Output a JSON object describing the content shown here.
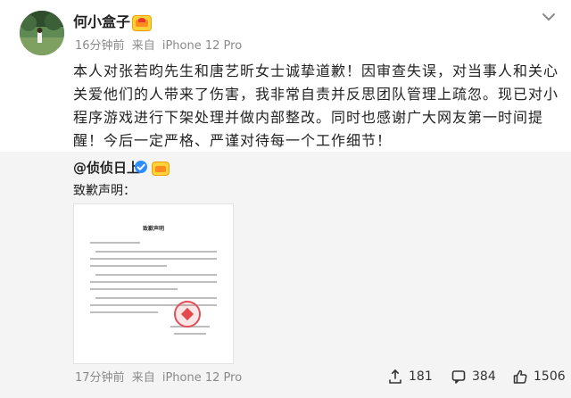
{
  "post": {
    "author": "何小盒子",
    "meta": {
      "time": "16分钟前",
      "source_prefix": "来自",
      "device": "iPhone 12 Pro"
    },
    "content": "本人对张若昀先生和唐艺昕女士诚挚道歉！因审查失误，对当事人和关心关爱他们的人带来了伤害，我非常自责并反思团队管理上疏忽。现已对小程序游戏进行下架处理并做内部整改。同时也感谢广大网友第一时间提醒！今后一定严格、严谨对待每一个工作细节！"
  },
  "repost": {
    "author": "@侦侦日上",
    "text": "致歉声明：",
    "image_title": "致歉声明",
    "meta": {
      "time": "17分钟前",
      "source_prefix": "来自",
      "device": "iPhone 12 Pro"
    },
    "actions": {
      "share": "181",
      "comment": "384",
      "like": "1506"
    }
  },
  "icons": {
    "more": "chevron-down-icon",
    "share": "share-icon",
    "comment": "comment-icon",
    "like": "like-icon"
  },
  "colors": {
    "meta_gray": "#8a8a8a",
    "repost_bg": "#f4f4f4",
    "verify_blue": "#2b8cff",
    "seal_red": "#e04a50"
  }
}
